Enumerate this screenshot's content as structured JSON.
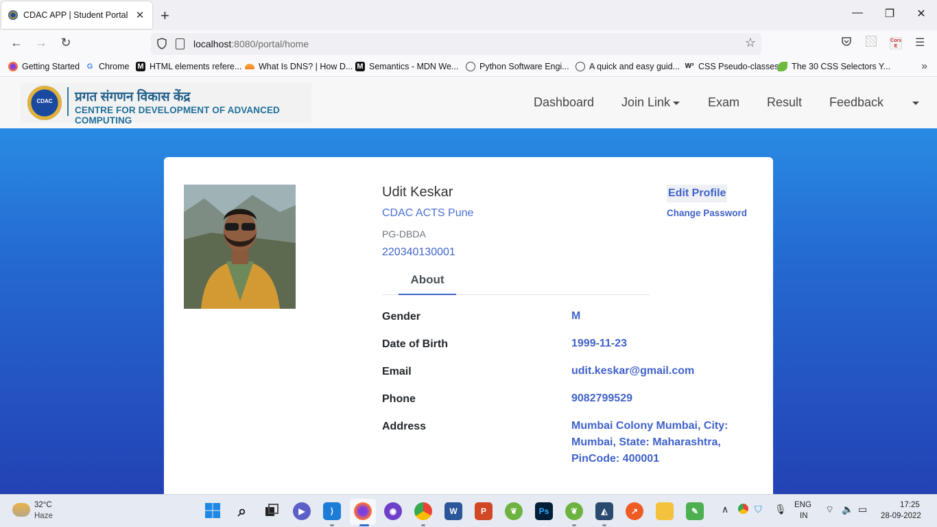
{
  "browser": {
    "tab_title": "CDAC APP | Student Portal",
    "url_host": "localhost",
    "url_path": ":8080/portal/home",
    "bookmarks": [
      {
        "label": "Getting Started",
        "icon": "firefox-icon"
      },
      {
        "label": "Chrome",
        "icon": "google-icon"
      },
      {
        "label": "HTML elements refere...",
        "icon": "mdn-icon"
      },
      {
        "label": "What Is DNS? | How D...",
        "icon": "cloudflare-icon"
      },
      {
        "label": "Semantics - MDN We...",
        "icon": "mdn-icon"
      },
      {
        "label": "Python Software Engi...",
        "icon": "globe-icon"
      },
      {
        "label": "A quick and easy guid...",
        "icon": "globe-icon"
      },
      {
        "label": "CSS Pseudo-classes",
        "icon": "w3-icon"
      },
      {
        "label": "The 30 CSS Selectors Y...",
        "icon": "leaf-icon"
      }
    ],
    "ext_cors_label": "Cors E"
  },
  "site": {
    "logo_hindi": "प्रगत संगणन विकास केंद्र",
    "logo_english": "CENTRE FOR DEVELOPMENT OF ADVANCED COMPUTING",
    "logo_emblem_text": "CDAC",
    "menu": {
      "dashboard": "Dashboard",
      "join_link": "Join Link",
      "exam": "Exam",
      "result": "Result",
      "feedback": "Feedback"
    }
  },
  "profile": {
    "name": "Udit Keskar",
    "center": "CDAC ACTS Pune",
    "course": "PG-DBDA",
    "prn": "220340130001",
    "edit_label": "Edit Profile",
    "change_password_label": "Change Password",
    "tab_about": "About",
    "fields": [
      {
        "label": "Gender",
        "value": "M"
      },
      {
        "label": "Date of Birth",
        "value": "1999-11-23"
      },
      {
        "label": "Email",
        "value": "udit.keskar@gmail.com"
      },
      {
        "label": "Phone",
        "value": "9082799529"
      },
      {
        "label": "Address",
        "value": "Mumbai Colony Mumbai, City: Mumbai, State: Maharashtra, PinCode: 400001"
      }
    ]
  },
  "taskbar": {
    "weather_temp": "32°C",
    "weather_desc": "Haze",
    "lang_1": "ENG",
    "lang_2": "IN",
    "time": "17:25",
    "date": "28-09-2022"
  },
  "colors": {
    "accent": "#3f62c9",
    "page_gradient_top": "#2a98ea",
    "page_gradient_bottom": "#2342b4"
  }
}
